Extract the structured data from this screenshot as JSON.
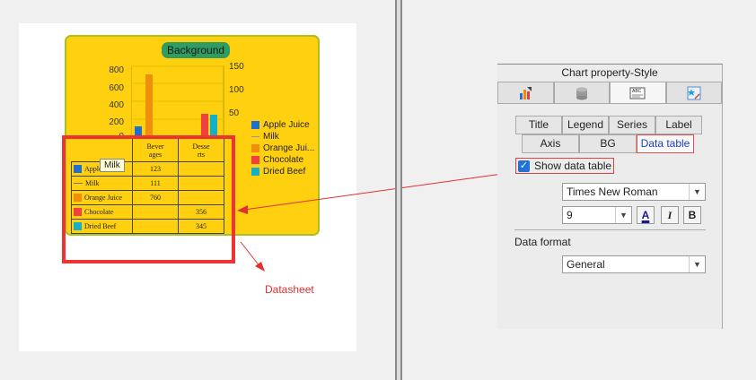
{
  "chart_preview": {
    "background_label": "Background",
    "left_axis_ticks": [
      "800",
      "600",
      "400",
      "200",
      "0"
    ],
    "right_axis_ticks": [
      "150",
      "100",
      "50"
    ],
    "legend": [
      {
        "label": "Apple Juice",
        "color": "#1f6fd0",
        "kind": "box"
      },
      {
        "label": "Milk",
        "color": "#999999",
        "kind": "line"
      },
      {
        "label": "Orange Jui...",
        "color": "#f0900a",
        "kind": "box"
      },
      {
        "label": "Chocolate",
        "color": "#f04040",
        "kind": "box"
      },
      {
        "label": "Dried Beef",
        "color": "#14b0c8",
        "kind": "box"
      }
    ],
    "bar_colors": {
      "apple": "#1f6fd0",
      "orange": "#f0900a",
      "chocolate": "#f04040",
      "beef": "#14b0c8"
    }
  },
  "data_table": {
    "col1_header": "Bever\nages",
    "col2_header": "Desse\nrts",
    "rows": [
      {
        "name": "Apple Juice",
        "beverages": "123",
        "desserts": ""
      },
      {
        "name": "Milk",
        "beverages": "111",
        "desserts": ""
      },
      {
        "name": "Orange Juice",
        "beverages": "760",
        "desserts": ""
      },
      {
        "name": "Chocolate",
        "beverages": "",
        "desserts": "356"
      },
      {
        "name": "Dried Beef",
        "beverages": "",
        "desserts": "345"
      }
    ]
  },
  "tooltip": "Milk",
  "annotation": "Datasheet",
  "panel": {
    "title": "Chart property-Style",
    "icon_tabs": [
      "chart-style-icon",
      "database-icon",
      "text-style-icon",
      "effects-icon"
    ],
    "tabs_row1": [
      "Title",
      "Legend",
      "Series",
      "Label"
    ],
    "tabs_row2": [
      "Axis",
      "BG",
      "Data table"
    ],
    "show_data_table_label": "Show data table",
    "show_data_table_checked": true,
    "font_family": "Times New Roman",
    "font_size": "9",
    "font_color_letter": "A",
    "italic_letter": "I",
    "bold_letter": "B",
    "data_format_label": "Data format",
    "data_format_value": "General"
  }
}
